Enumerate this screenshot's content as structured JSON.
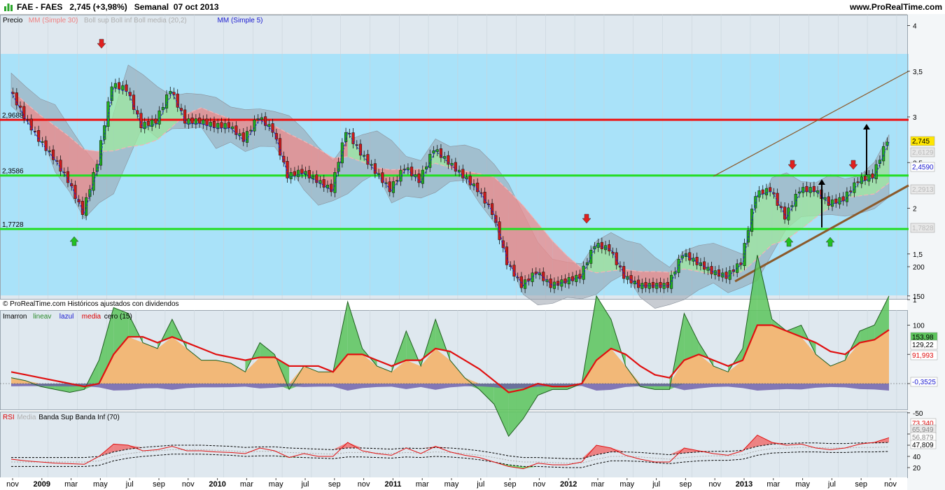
{
  "header": {
    "instrument": "FAE - FAES",
    "price": "2,745 (+3,98%)",
    "period": "Semanal",
    "date": "07 oct 2013",
    "website": "www.ProRealTime.com"
  },
  "colors": {
    "upper_zone": "#a9e2f9",
    "resistance": "#ee1111",
    "support": "#22dd22",
    "trend": "#8b5a2b"
  },
  "price_panel": {
    "legend": [
      {
        "text": "Precio",
        "color": "#000000"
      },
      {
        "text": "MM (Simple 30)",
        "color": "#f08080"
      },
      {
        "text": "Boll sup Boll inf Boll media (20,2)",
        "color": "#b0b0b0"
      },
      {
        "text": "MM (Simple 5)",
        "color": "#1a1ad0"
      }
    ],
    "level_labels": [
      "2,9688",
      "2,3586",
      "1,7728"
    ],
    "yaxis_ticks": [
      "4",
      "3,5",
      "3",
      "2,5",
      "2",
      "1,5",
      "1"
    ],
    "value_badges": [
      "2,745",
      "2,4590",
      "2,6129",
      "2,2913",
      "1,7828"
    ],
    "footer": "© ProRealTime.com  Históricos ajustados con dividendos",
    "signals": [
      {
        "type": "down",
        "date": "2009-05"
      },
      {
        "type": "up",
        "date": "2009-03"
      },
      {
        "type": "down",
        "date": "2012-02"
      },
      {
        "type": "down",
        "date": "2013-03"
      },
      {
        "type": "up",
        "date": "2013-03"
      },
      {
        "type": "up",
        "date": "2013-06"
      },
      {
        "type": "down",
        "date": "2013-08"
      },
      {
        "type": "target",
        "date": "2013-05"
      },
      {
        "type": "target",
        "date": "2013-09"
      }
    ]
  },
  "imarron_panel": {
    "legend": [
      {
        "text": "Imarron",
        "color": "#000000"
      },
      {
        "text": "lineav",
        "color": "#2a8a2a"
      },
      {
        "text": "lazul",
        "color": "#1a1ad0"
      },
      {
        "text": "media",
        "color": "#dd0000"
      },
      {
        "text": "cero (15)",
        "color": "#000000"
      }
    ],
    "yaxis_ticks": [
      "200",
      "150",
      "100",
      "50",
      "0",
      "-50"
    ],
    "value_badges": [
      "153,98",
      "129,22",
      "91,993",
      "-0,3525"
    ]
  },
  "rsi_panel": {
    "legend": [
      {
        "text": "RSI",
        "color": "#dd0000"
      },
      {
        "text": "Media",
        "color": "#b0b0b0"
      },
      {
        "text": "Banda Sup Banda Inf (70)",
        "color": "#000000"
      }
    ],
    "yaxis_ticks": [
      "80",
      "60",
      "40",
      "20"
    ],
    "value_badges": [
      "73,340",
      "65,949",
      "56,879",
      "47,809"
    ]
  },
  "xaxis": {
    "labels": [
      "nov",
      "2009",
      "mar",
      "may",
      "jul",
      "sep",
      "nov",
      "2010",
      "mar",
      "may",
      "jul",
      "sep",
      "nov",
      "2011",
      "mar",
      "may",
      "jul",
      "sep",
      "nov",
      "2012",
      "mar",
      "may",
      "jul",
      "sep",
      "nov",
      "2013",
      "mar",
      "may",
      "jul",
      "sep",
      "nov"
    ]
  },
  "chart_data": [
    {
      "type": "candlestick",
      "title": "FAE - FAES Semanal",
      "x_range": [
        "2008-10",
        "2013-11"
      ],
      "ylim": [
        1,
        4.1
      ],
      "horizontal_levels": [
        2.9688,
        2.3586,
        1.7728
      ],
      "close_series": [
        {
          "date": "2008-10",
          "value": 3.3
        },
        {
          "date": "2008-11",
          "value": 3.0
        },
        {
          "date": "2008-12",
          "value": 2.75
        },
        {
          "date": "2009-01",
          "value": 2.55
        },
        {
          "date": "2009-02",
          "value": 2.3
        },
        {
          "date": "2009-03",
          "value": 1.95
        },
        {
          "date": "2009-04",
          "value": 2.5
        },
        {
          "date": "2009-05",
          "value": 3.35
        },
        {
          "date": "2009-06",
          "value": 3.3
        },
        {
          "date": "2009-07",
          "value": 2.9
        },
        {
          "date": "2009-08",
          "value": 2.95
        },
        {
          "date": "2009-09",
          "value": 3.3
        },
        {
          "date": "2009-10",
          "value": 2.95
        },
        {
          "date": "2009-11",
          "value": 2.95
        },
        {
          "date": "2009-12",
          "value": 2.9
        },
        {
          "date": "2010-01",
          "value": 2.9
        },
        {
          "date": "2010-02",
          "value": 2.75
        },
        {
          "date": "2010-03",
          "value": 3.0
        },
        {
          "date": "2010-04",
          "value": 2.85
        },
        {
          "date": "2010-05",
          "value": 2.35
        },
        {
          "date": "2010-06",
          "value": 2.4
        },
        {
          "date": "2010-07",
          "value": 2.3
        },
        {
          "date": "2010-08",
          "value": 2.2
        },
        {
          "date": "2010-09",
          "value": 2.85
        },
        {
          "date": "2010-10",
          "value": 2.6
        },
        {
          "date": "2010-11",
          "value": 2.4
        },
        {
          "date": "2010-12",
          "value": 2.2
        },
        {
          "date": "2011-01",
          "value": 2.45
        },
        {
          "date": "2011-02",
          "value": 2.3
        },
        {
          "date": "2011-03",
          "value": 2.65
        },
        {
          "date": "2011-04",
          "value": 2.5
        },
        {
          "date": "2011-05",
          "value": 2.35
        },
        {
          "date": "2011-06",
          "value": 2.2
        },
        {
          "date": "2011-07",
          "value": 1.95
        },
        {
          "date": "2011-08",
          "value": 1.4
        },
        {
          "date": "2011-09",
          "value": 1.15
        },
        {
          "date": "2011-10",
          "value": 1.3
        },
        {
          "date": "2011-11",
          "value": 1.15
        },
        {
          "date": "2011-12",
          "value": 1.2
        },
        {
          "date": "2012-01",
          "value": 1.25
        },
        {
          "date": "2012-02",
          "value": 1.6
        },
        {
          "date": "2012-03",
          "value": 1.55
        },
        {
          "date": "2012-04",
          "value": 1.25
        },
        {
          "date": "2012-05",
          "value": 1.15
        },
        {
          "date": "2012-06",
          "value": 1.15
        },
        {
          "date": "2012-07",
          "value": 1.15
        },
        {
          "date": "2012-08",
          "value": 1.5
        },
        {
          "date": "2012-09",
          "value": 1.4
        },
        {
          "date": "2012-10",
          "value": 1.3
        },
        {
          "date": "2012-11",
          "value": 1.25
        },
        {
          "date": "2012-12",
          "value": 1.4
        },
        {
          "date": "2013-01",
          "value": 2.15
        },
        {
          "date": "2013-02",
          "value": 2.2
        },
        {
          "date": "2013-03",
          "value": 1.9
        },
        {
          "date": "2013-04",
          "value": 2.2
        },
        {
          "date": "2013-05",
          "value": 2.2
        },
        {
          "date": "2013-06",
          "value": 2.05
        },
        {
          "date": "2013-07",
          "value": 2.1
        },
        {
          "date": "2013-08",
          "value": 2.3
        },
        {
          "date": "2013-09",
          "value": 2.35
        },
        {
          "date": "2013-10",
          "value": 2.745
        }
      ]
    },
    {
      "type": "area",
      "title": "Imarron lineav lazul media cero (15)",
      "ylim": [
        -75,
        225
      ],
      "series": [
        {
          "name": "lineav",
          "values": [
            10,
            5,
            -5,
            -10,
            -15,
            -10,
            40,
            130,
            120,
            70,
            60,
            110,
            60,
            40,
            40,
            35,
            20,
            70,
            50,
            -10,
            30,
            20,
            20,
            140,
            60,
            30,
            20,
            90,
            30,
            110,
            40,
            10,
            -10,
            -35,
            -90,
            -60,
            -20,
            -10,
            -10,
            0,
            150,
            110,
            30,
            -5,
            -10,
            -10,
            120,
            70,
            30,
            20,
            60,
            220,
            110,
            90,
            100,
            50,
            30,
            40,
            90,
            100,
            150
          ]
        },
        {
          "name": "media",
          "values": [
            20,
            15,
            10,
            5,
            0,
            -5,
            0,
            50,
            80,
            80,
            70,
            80,
            70,
            60,
            50,
            45,
            40,
            45,
            45,
            30,
            30,
            30,
            20,
            50,
            50,
            40,
            30,
            40,
            40,
            60,
            55,
            40,
            25,
            5,
            -15,
            -10,
            0,
            -5,
            -5,
            0,
            40,
            60,
            50,
            30,
            15,
            10,
            40,
            50,
            40,
            30,
            40,
            100,
            100,
            90,
            80,
            70,
            55,
            50,
            70,
            75,
            92
          ]
        }
      ],
      "x_range": [
        "2008-10",
        "2013-10"
      ]
    },
    {
      "type": "line",
      "title": "RSI Media Banda Sup Banda Inf (70)",
      "ylim": [
        10,
        90
      ],
      "series": [
        {
          "name": "RSI",
          "values": [
            35,
            32,
            30,
            28,
            27,
            26,
            40,
            62,
            60,
            50,
            52,
            58,
            50,
            50,
            48,
            47,
            45,
            55,
            50,
            38,
            45,
            40,
            40,
            65,
            50,
            45,
            42,
            55,
            45,
            58,
            48,
            42,
            38,
            30,
            22,
            18,
            28,
            25,
            25,
            30,
            60,
            55,
            42,
            35,
            30,
            30,
            55,
            50,
            45,
            42,
            50,
            78,
            65,
            60,
            62,
            55,
            52,
            55,
            62,
            65,
            73.34
          ]
        },
        {
          "name": "Media",
          "values": [
            30,
            30,
            30,
            30,
            30,
            30,
            32,
            40,
            45,
            48,
            50,
            52,
            52,
            52,
            51,
            50,
            48,
            49,
            49,
            47,
            46,
            45,
            44,
            47,
            47,
            46,
            45,
            47,
            46,
            48,
            47,
            45,
            42,
            38,
            33,
            30,
            30,
            29,
            28,
            28,
            35,
            40,
            40,
            39,
            37,
            35,
            38,
            40,
            41,
            41,
            43,
            50,
            54,
            55,
            56,
            56,
            55,
            55,
            56,
            56,
            56.879
          ]
        }
      ],
      "x_range": [
        "2008-10",
        "2013-10"
      ]
    }
  ]
}
